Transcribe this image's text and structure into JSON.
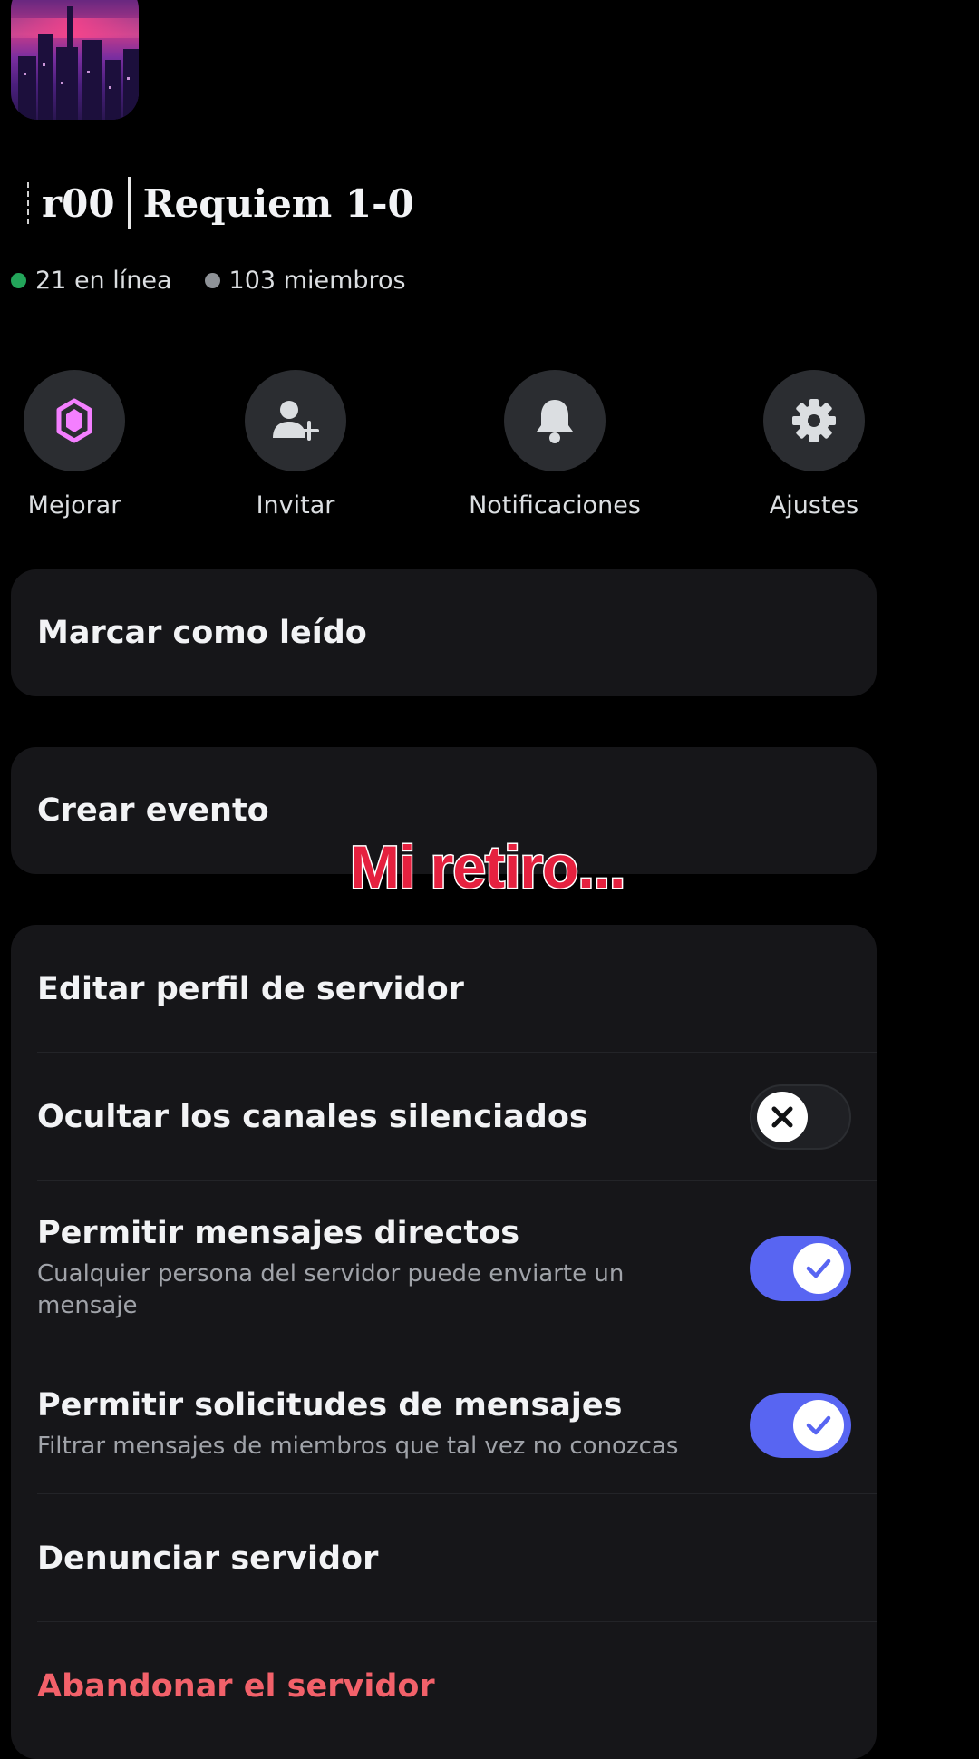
{
  "server": {
    "name_part1": "r00",
    "name_part2": "Requiem 1-0",
    "online_text": "21 en línea",
    "members_text": "103 miembros"
  },
  "actions": [
    {
      "label": "Mejorar",
      "icon": "boost-gem-icon"
    },
    {
      "label": "Invitar",
      "icon": "add-user-icon"
    },
    {
      "label": "Notificaciones",
      "icon": "bell-icon"
    },
    {
      "label": "Ajustes",
      "icon": "gear-icon"
    }
  ],
  "menu": {
    "mark_read": "Marcar como leído",
    "create_event": "Crear evento",
    "edit_profile": "Editar perfil de servidor",
    "hide_muted": {
      "label": "Ocultar los canales silenciados",
      "enabled": false
    },
    "allow_dms": {
      "label": "Permitir mensajes directos",
      "sublabel": "Cualquier persona del servidor puede enviarte un mensaje",
      "enabled": true
    },
    "allow_requests": {
      "label": "Permitir solicitudes de mensajes",
      "sublabel": "Filtrar mensajes de miembros que tal vez no conozcas",
      "enabled": true
    },
    "report": "Denunciar servidor",
    "leave": "Abandonar el servidor"
  },
  "overlay_caption": "Mi retiro...",
  "colors": {
    "background": "#000000",
    "card": "#161619",
    "online": "#23a55a",
    "accent": "#5865f2",
    "danger": "#f2616a",
    "boost": "#f47fff",
    "caption": "#e5213f"
  }
}
